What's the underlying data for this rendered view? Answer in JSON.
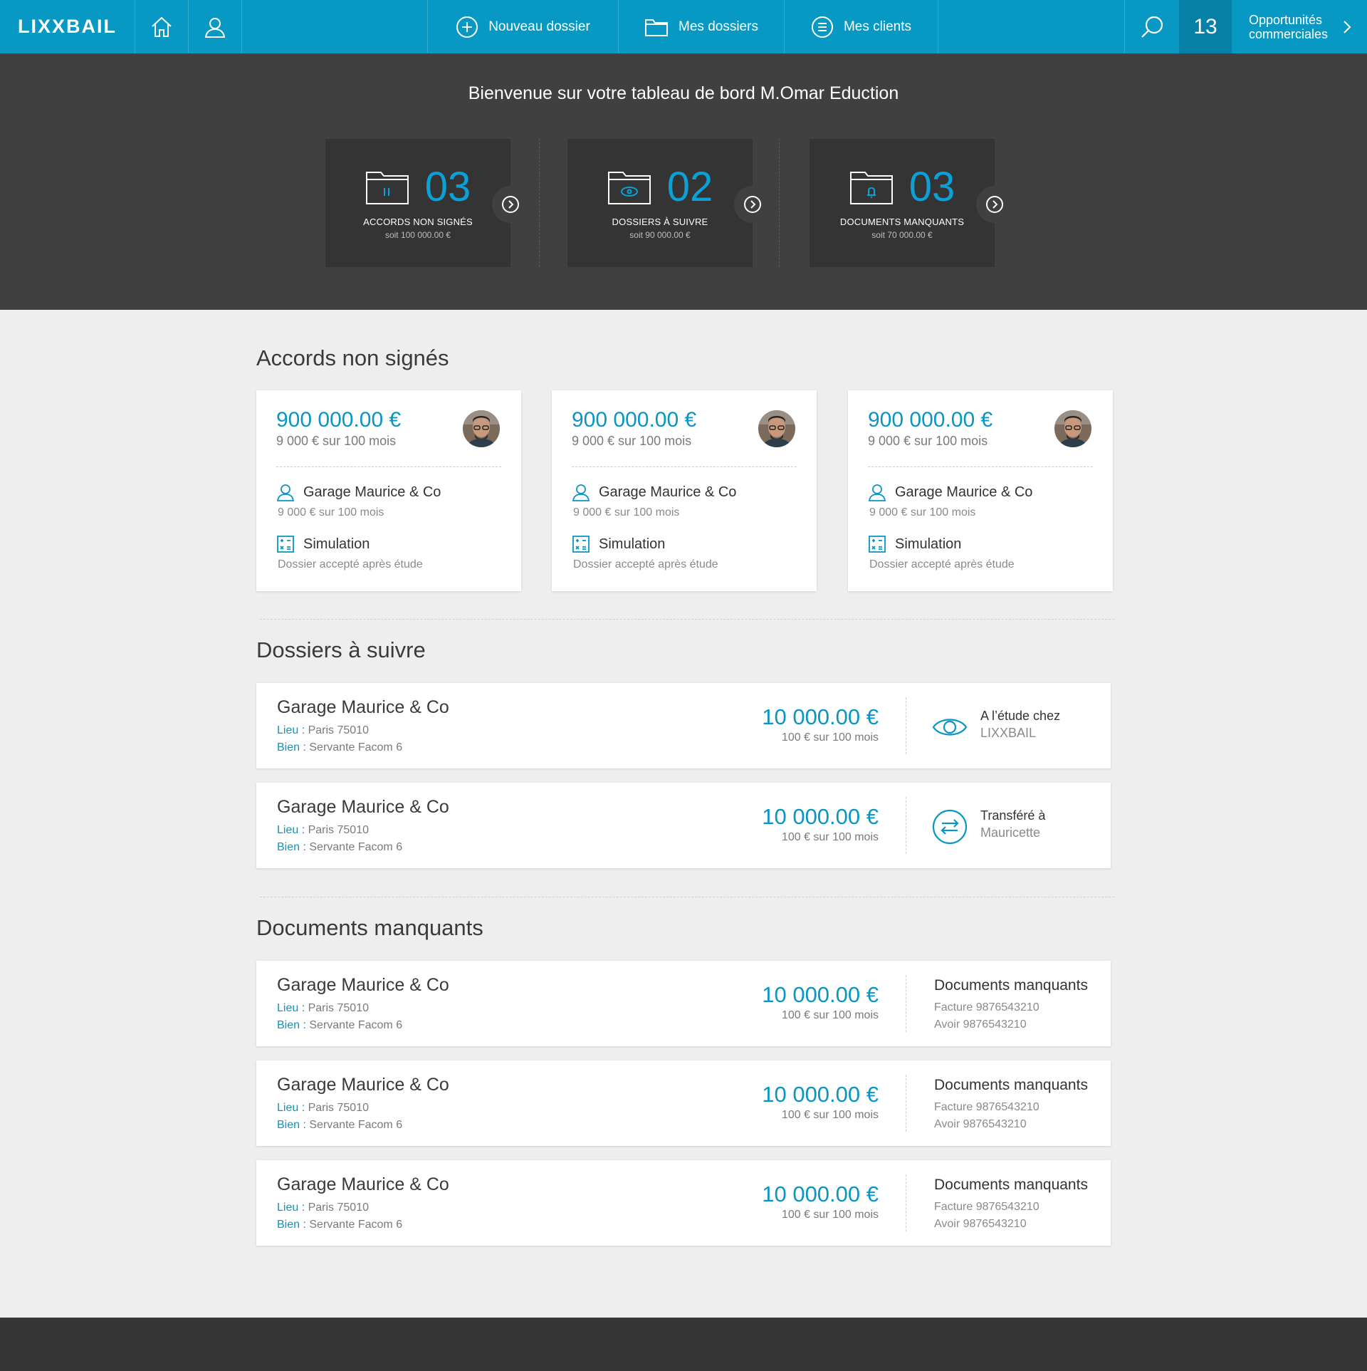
{
  "nav": {
    "logo": "LIXXBAIL",
    "new_file": "Nouveau dossier",
    "my_files": "Mes dossiers",
    "my_clients": "Mes clients",
    "counter": "13",
    "opportunities_line1": "Opportunités",
    "opportunities_line2": "commerciales"
  },
  "hero": {
    "welcome": "Bienvenue sur votre tableau de bord M.Omar Eduction",
    "stats": [
      {
        "value": "03",
        "label": "ACCORDS NON SIGNÉS",
        "sub": "soit 100 000.00 €"
      },
      {
        "value": "02",
        "label": "DOSSIERS À SUIVRE",
        "sub": "soit 90 000.00 €"
      },
      {
        "value": "03",
        "label": "DOCUMENTS MANQUANTS",
        "sub": "soit 70 000.00 €"
      }
    ]
  },
  "accords": {
    "title": "Accords non signés",
    "cards": [
      {
        "amount": "900 000.00 €",
        "amount_sub": "9 000 € sur 100 mois",
        "client": "Garage Maurice & Co",
        "client_sub": "9 000 € sur 100 mois",
        "type": "Simulation",
        "type_sub": "Dossier accepté après étude"
      },
      {
        "amount": "900 000.00 €",
        "amount_sub": "9 000 € sur 100 mois",
        "client": "Garage Maurice & Co",
        "client_sub": "9 000 € sur 100 mois",
        "type": "Simulation",
        "type_sub": "Dossier accepté après étude"
      },
      {
        "amount": "900 000.00 €",
        "amount_sub": "9 000 € sur 100 mois",
        "client": "Garage Maurice & Co",
        "client_sub": "9 000 € sur 100 mois",
        "type": "Simulation",
        "type_sub": "Dossier accepté après étude"
      }
    ]
  },
  "suivre": {
    "title": "Dossiers à suivre",
    "rows": [
      {
        "name": "Garage Maurice & Co",
        "lieu_key": "Lieu :",
        "lieu": "Paris 75010",
        "bien_key": "Bien :",
        "bien": "Servante Facom 6",
        "price": "10 000.00 €",
        "price_sub": "100 € sur 100 mois",
        "status_l1": "A l’étude chez",
        "status_l2": "LIXXBAIL",
        "icon": "eye-icon"
      },
      {
        "name": "Garage Maurice & Co",
        "lieu_key": "Lieu :",
        "lieu": "Paris 75010",
        "bien_key": "Bien :",
        "bien": "Servante Facom 6",
        "price": "10 000.00 €",
        "price_sub": "100 € sur 100 mois",
        "status_l1": "Transféré à",
        "status_l2": "Mauricette",
        "icon": "transfer-icon"
      }
    ]
  },
  "documents": {
    "title": "Documents manquants",
    "rows": [
      {
        "name": "Garage Maurice & Co",
        "lieu_key": "Lieu :",
        "lieu": "Paris 75010",
        "bien_key": "Bien :",
        "bien": "Servante Facom 6",
        "price": "10 000.00 €",
        "price_sub": "100 € sur 100 mois",
        "doc_title": "Documents manquants",
        "doc_l1": "Facture 9876543210",
        "doc_l2": "Avoir 9876543210"
      },
      {
        "name": "Garage Maurice & Co",
        "lieu_key": "Lieu :",
        "lieu": "Paris 75010",
        "bien_key": "Bien :",
        "bien": "Servante Facom 6",
        "price": "10 000.00 €",
        "price_sub": "100 € sur 100 mois",
        "doc_title": "Documents manquants",
        "doc_l1": "Facture 9876543210",
        "doc_l2": "Avoir 9876543210"
      },
      {
        "name": "Garage Maurice & Co",
        "lieu_key": "Lieu :",
        "lieu": "Paris 75010",
        "bien_key": "Bien :",
        "bien": "Servante Facom 6",
        "price": "10 000.00 €",
        "price_sub": "100 € sur 100 mois",
        "doc_title": "Documents manquants",
        "doc_l1": "Facture 9876543210",
        "doc_l2": "Avoir 9876543210"
      }
    ]
  },
  "colors": {
    "brand": "#0798c4",
    "accent": "#0a95c5",
    "hero_bg": "#404040"
  }
}
